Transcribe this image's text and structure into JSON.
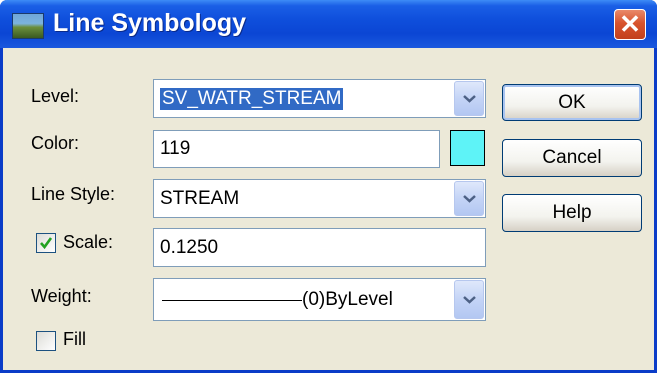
{
  "window": {
    "title": "Line Symbology",
    "close_glyph": "✕"
  },
  "level": {
    "label": "Level:",
    "value": "SV_WATR_STREAM"
  },
  "color": {
    "label": "Color:",
    "value": "119",
    "swatch_hex": "#5ef3f7"
  },
  "line_style": {
    "label": "Line Style:",
    "value": "STREAM"
  },
  "scale": {
    "label": "Scale:",
    "checked": true,
    "value": "0.1250"
  },
  "weight": {
    "label": "Weight:",
    "value": "(0)ByLevel"
  },
  "fill": {
    "label": "Fill",
    "checked": false
  },
  "buttons": {
    "ok": "OK",
    "cancel": "Cancel",
    "help": "Help"
  }
}
